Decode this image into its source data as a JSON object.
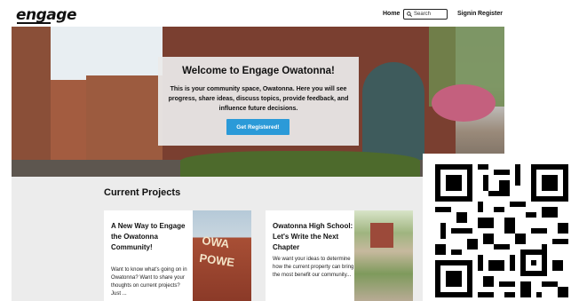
{
  "header": {
    "logo": "engage",
    "nav": {
      "home": "Home",
      "search_placeholder": "Search",
      "signin": "Signin",
      "register": "Register"
    }
  },
  "hero": {
    "title": "Welcome to Engage Owatonna!",
    "body": "This is your community space, Owatonna. Here you will see progress, share ideas, discuss topics, provide feedback, and influence future decisions.",
    "cta": "Get Registered!",
    "image": "downtown-owatonna-street-photo"
  },
  "projects": {
    "title": "Current Projects",
    "items": [
      {
        "title": "A New Way to Engage the Owatonna Community!",
        "desc": "Want to know what's going on in Owatonna? Want to share your thoughts on current projects? Just ...",
        "image_text": "OWA POWE"
      },
      {
        "title": "Owatonna High School: Let's Write the Next Chapter",
        "desc": "We want your ideas to determine how the current property can bring the most benefit our community...",
        "image": "aerial-school-photo"
      }
    ]
  },
  "overlay": {
    "qr": "qr-code"
  },
  "colors": {
    "accent": "#2b9ad8",
    "section_bg": "#ececec"
  }
}
